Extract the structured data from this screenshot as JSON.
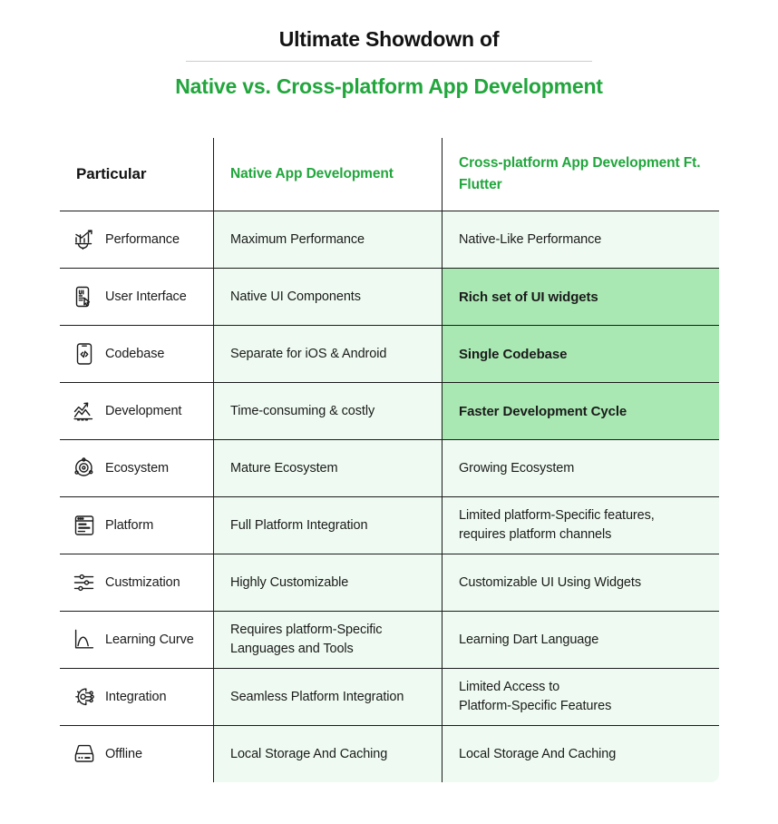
{
  "title": {
    "line1": "Ultimate Showdown of",
    "line2": "Native vs. Cross-platform App Development"
  },
  "colors": {
    "brand_green": "#21a63c",
    "cell_tint": "#effbf2",
    "highlight_green": "#a9e8b2",
    "text": "#1b1b1b",
    "border": "#1b1b1b"
  },
  "table": {
    "headers": {
      "col1": "Particular",
      "col2": "Native App Development",
      "col3": "Cross-platform App Development Ft. Flutter"
    },
    "rows": [
      {
        "icon": "performance-chart-icon",
        "label": "Performance",
        "native": "Maximum Performance",
        "cross": "Native-Like Performance",
        "cross_highlight": false,
        "cross_bold": false
      },
      {
        "icon": "ui-phone-cursor-icon",
        "label": "User Interface",
        "native": "Native UI Components",
        "cross": "Rich set of UI widgets",
        "cross_highlight": true,
        "cross_bold": true
      },
      {
        "icon": "phone-code-icon",
        "label": "Codebase",
        "native": "Separate for iOS & Android",
        "cross": "Single Codebase",
        "cross_highlight": true,
        "cross_bold": true
      },
      {
        "icon": "growth-arrow-icon",
        "label": "Development",
        "native": "Time-consuming & costly",
        "cross": "Faster Development Cycle",
        "cross_highlight": true,
        "cross_bold": true
      },
      {
        "icon": "atom-orbit-icon",
        "label": "Ecosystem",
        "native": "Mature Ecosystem",
        "cross": "Growing Ecosystem",
        "cross_highlight": false,
        "cross_bold": false
      },
      {
        "icon": "browser-window-icon",
        "label": "Platform",
        "native": "Full Platform Integration",
        "cross": "Limited platform-Specific features,\nrequires platform channels",
        "cross_highlight": false,
        "cross_bold": false
      },
      {
        "icon": "sliders-icon",
        "label": "Custmization",
        "native": "Highly Customizable",
        "cross": "Customizable UI Using Widgets",
        "cross_highlight": false,
        "cross_bold": false
      },
      {
        "icon": "curve-graph-icon",
        "label": "Learning Curve",
        "native": "Requires platform-Specific\nLanguages and Tools",
        "cross": "Learning Dart Language",
        "cross_highlight": false,
        "cross_bold": false
      },
      {
        "icon": "gear-nodes-icon",
        "label": "Integration",
        "native": "Seamless Platform Integration",
        "cross": "Limited Access to\nPlatform-Specific Features",
        "cross_highlight": false,
        "cross_bold": false
      },
      {
        "icon": "hard-drive-icon",
        "label": "Offline",
        "native": "Local Storage And Caching",
        "cross": "Local Storage And Caching",
        "cross_highlight": false,
        "cross_bold": false
      }
    ]
  }
}
